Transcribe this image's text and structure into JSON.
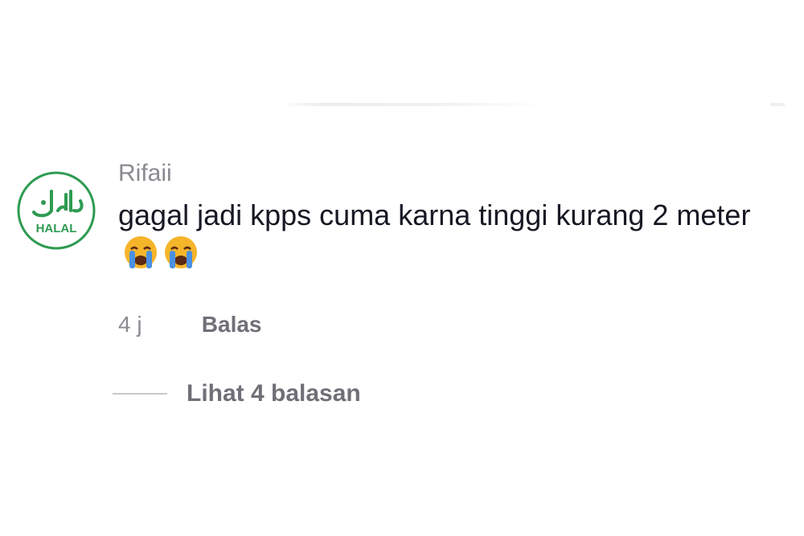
{
  "comment": {
    "username": "Rifaii",
    "avatar_text": "HALAL",
    "avatar_arabic": "حلال",
    "text": "gagal jadi kpps cuma karna tinggi kurang 2 meter",
    "emoji": [
      "loudly-crying-face-icon",
      "loudly-crying-face-icon"
    ],
    "time": "4 j",
    "reply_label": "Balas",
    "view_replies_label": "Lihat 4 balasan"
  },
  "colors": {
    "avatar_green": "#2e9b52",
    "meta_gray": "#8a8b91",
    "text_dark": "#161823"
  }
}
